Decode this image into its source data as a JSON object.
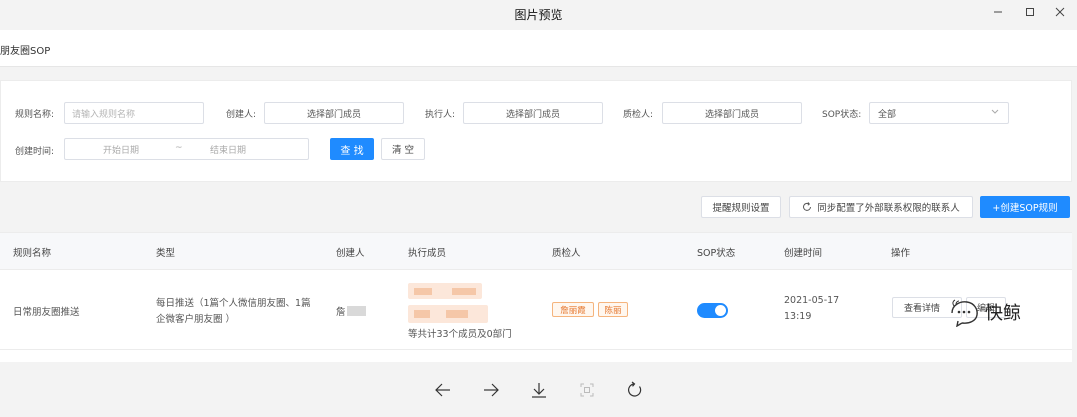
{
  "window": {
    "title": "图片预览"
  },
  "page": {
    "title": "朋友圈SOP"
  },
  "filters": {
    "rule_name_label": "规则名称:",
    "rule_name_placeholder": "请输入规则名称",
    "creator_label": "创建人:",
    "creator_value": "选择部门成员",
    "executor_label": "执行人:",
    "executor_value": "选择部门成员",
    "inspector_label": "质检人:",
    "inspector_value": "选择部门成员",
    "sop_status_label": "SOP状态:",
    "sop_status_value": "全部",
    "created_time_label": "创建时间:",
    "start_date": "开始日期",
    "date_separator": "~",
    "end_date": "结束日期",
    "search_button": "查 找",
    "clear_button": "清 空"
  },
  "toolbar": {
    "reminder_rules": "提醒规则设置",
    "sync_config": "同步配置了外部联系权限的联系人",
    "create_rule": "+创建SOP规则"
  },
  "table": {
    "columns": [
      "规则名称",
      "类型",
      "创建人",
      "执行成员",
      "质检人",
      "SOP状态",
      "创建时间",
      "操作"
    ],
    "rows": [
      {
        "name": "日常朋友圈推送",
        "type_line1": "每日推送（1篇个人微信朋友圈、1篇",
        "type_line2": "企微客户朋友圈 ）",
        "creator": "詹",
        "members_summary": "等共计33个成员及0部门",
        "inspector_tag1": "詹丽霞",
        "inspector_tag2": "陈丽",
        "sop_status_on": true,
        "created_date": "2021-05-17",
        "created_time": "13:19",
        "action_view": "查看详情",
        "action_more": "编辑"
      }
    ]
  },
  "watermark": {
    "text": "快鲸"
  },
  "colors": {
    "primary": "#1f8bff",
    "tag_orange": "#e6772e"
  }
}
